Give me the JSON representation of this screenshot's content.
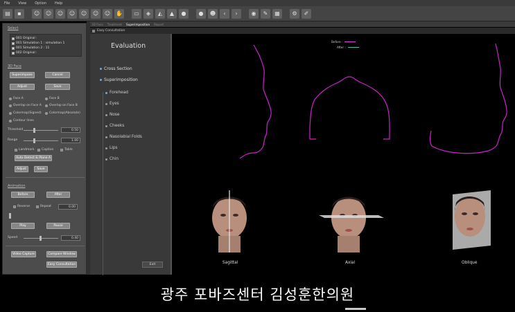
{
  "menu": [
    "File",
    "View",
    "Option",
    "Help"
  ],
  "toolbar": {
    "icons": [
      "open-folder-icon",
      "save-icon",
      "face-icon",
      "face-icon",
      "face-icon",
      "face-icon",
      "face-icon",
      "face-icon",
      "face-icon",
      "ruler-icon",
      "cube-icon",
      "mesh-icon",
      "mesh-icon",
      "sphere-icon",
      "bulb-icon",
      "portrait-icon",
      "chevron-left-icon",
      "chevron-right-icon",
      "head-icon",
      "edit-icon",
      "report-icon",
      "settings-icon",
      "pen-icon"
    ]
  },
  "select_section": {
    "title": "Select",
    "files": [
      "001 Original :",
      "001 Simulation 1 : simulation 1",
      "001 Simulation 2 : 11",
      "002 Original :"
    ]
  },
  "face_section": {
    "title": "3D Face",
    "buttons": {
      "superimpose": "Superimpose",
      "cancel": "Cancel",
      "adjust": "Adjust",
      "save": "Save"
    },
    "radios": {
      "face_a": "Face A",
      "face_b": "Face B",
      "overlap_a": "Overlap on Face A",
      "overlap_b": "Overlap on Face B",
      "colormap_signed": "Colormap(Signed)",
      "colormap_absolute": "Colormap(Absolute)",
      "contour": "Contour lines"
    },
    "threshold_label": "Threshold",
    "threshold_value": "0.50",
    "range_label": "Range",
    "range_value": "1.00",
    "checks": {
      "landmark": "Landmark",
      "caption": "Caption",
      "table": "Table"
    },
    "auto_detect": "Auto Detect & Plane A",
    "adjust2": "Adjust",
    "save2": "Save"
  },
  "animation_section": {
    "title": "Animation",
    "before": "Before",
    "after": "After",
    "reverse": "Reverse",
    "repeat": "Repeat",
    "repeat_value": "0.00",
    "play": "Play",
    "pause": "Pause",
    "speed_label": "Speed",
    "speed_value": "0.40"
  },
  "bottom_buttons": {
    "video_capture": "Video Capture",
    "compare_window": "Compare Window",
    "easy_consultation": "Easy Consultation"
  },
  "tabs": [
    "3D Face",
    "Treatment",
    "Superimposition",
    "Report"
  ],
  "window": {
    "title": "Easy Consultation",
    "eval_title": "Evaluation",
    "main_items": [
      "Cross Section",
      "Superimposition"
    ],
    "sub_items": [
      "Forehead",
      "Eyes",
      "Nose",
      "Cheeks",
      "Nasolabial Folds",
      "Lips",
      "Chin"
    ],
    "exit": "Exit"
  },
  "legend": {
    "before": "Before :",
    "after": "After :"
  },
  "colors": {
    "before": "#e040e0",
    "after": "#3fbfbf",
    "accent": "#7aa7d8"
  },
  "views": [
    "Sagittal",
    "Axial",
    "Oblique"
  ],
  "caption": "광주 포바즈센터 김성훈한의원"
}
